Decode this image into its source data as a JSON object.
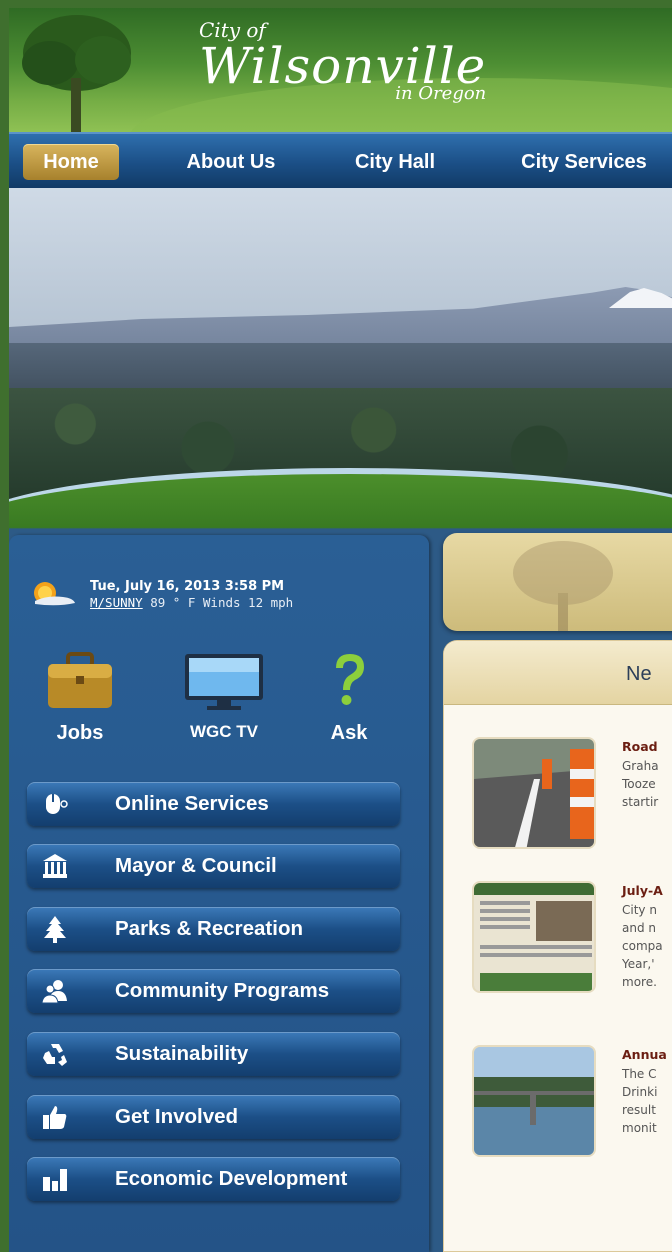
{
  "header": {
    "logo_city_of": "City of",
    "logo_name": "Wilsonville",
    "logo_in_oregon": "in Oregon"
  },
  "nav": {
    "items": [
      {
        "label": "Home",
        "active": true
      },
      {
        "label": "About Us",
        "active": false
      },
      {
        "label": "City Hall",
        "active": false
      },
      {
        "label": "City Services",
        "active": false
      }
    ]
  },
  "weather": {
    "datetime": "Tue, July 16, 2013 3:58 PM",
    "condition_link": "M/SUNNY",
    "details": " 89 ° F Winds 12 mph",
    "icon": "sun-cloud-icon"
  },
  "quick_links": [
    {
      "label": "Jobs",
      "icon": "briefcase-icon"
    },
    {
      "label": "WGC TV",
      "icon": "tv-icon"
    },
    {
      "label": "Ask",
      "icon": "question-mark-icon"
    }
  ],
  "menu": [
    {
      "label": "Online Services",
      "icon": "mouse-icon"
    },
    {
      "label": "Mayor & Council",
      "icon": "city-hall-icon"
    },
    {
      "label": "Parks & Recreation",
      "icon": "pine-tree-icon"
    },
    {
      "label": "Community Programs",
      "icon": "people-icon"
    },
    {
      "label": "Sustainability",
      "icon": "recycle-icon"
    },
    {
      "label": "Get Involved",
      "icon": "thumbs-up-icon"
    },
    {
      "label": "Economic Development",
      "icon": "bar-chart-icon"
    }
  ],
  "news": {
    "header": "Ne",
    "stories": [
      {
        "title": "Road",
        "lines": [
          "Graha",
          "Tooze",
          "startir"
        ]
      },
      {
        "title": "July-A",
        "lines": [
          "City n",
          "and n",
          "compa",
          "Year,'",
          "more."
        ]
      },
      {
        "title": "Annua",
        "lines": [
          "The C",
          "Drinki",
          "result",
          "monit"
        ]
      }
    ]
  },
  "colors": {
    "nav_blue": "#1b4f86",
    "home_gold": "#a7812c",
    "panel_blue": "#2a5f95",
    "header_green": "#4d8e33",
    "news_title_red": "#6b1e12"
  }
}
